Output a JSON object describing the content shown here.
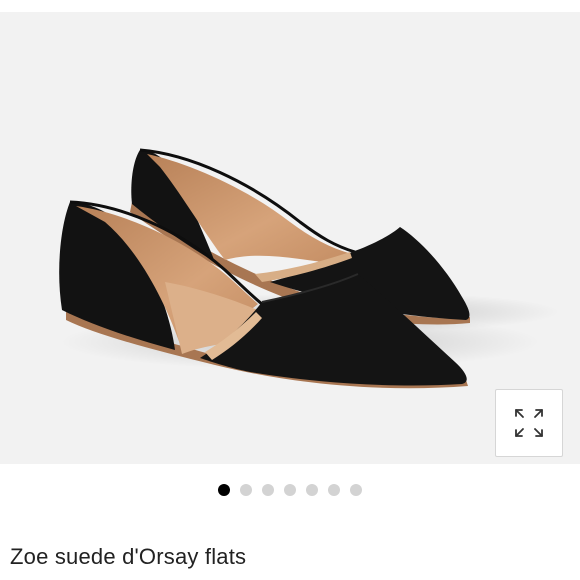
{
  "product": {
    "title": "Zoe suede d'Orsay flats",
    "image_alt": "Black suede pointed-toe d'Orsay flats with tan leather lining"
  },
  "gallery": {
    "total_images": 7,
    "active_index": 0,
    "expand_icon": "expand-arrows-icon"
  },
  "colors": {
    "image_background": "#f2f2f2",
    "shoe_suede": "#111111",
    "lining": "#c8946a",
    "sole": "#a87652",
    "dot_active": "#000000",
    "dot_inactive": "#d3d3d3"
  }
}
